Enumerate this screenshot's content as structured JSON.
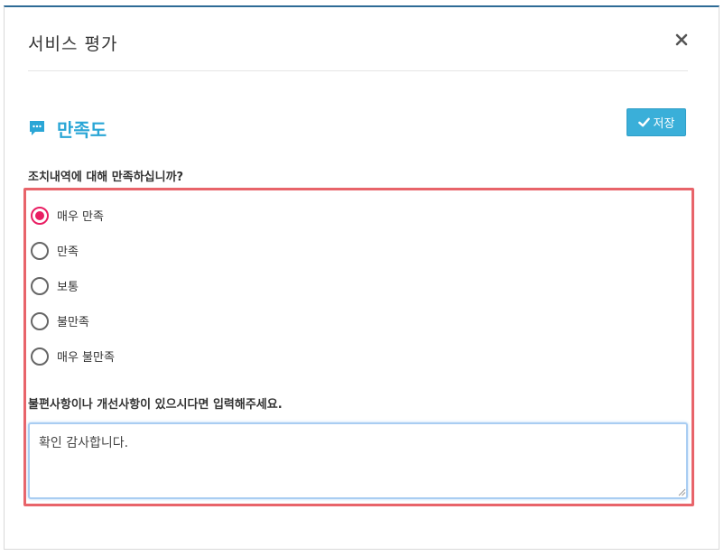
{
  "modal": {
    "title": "서비스 평가",
    "close_label": "×"
  },
  "section": {
    "icon": "speech-bubble-icon",
    "title": "만족도",
    "save_label": "저장",
    "save_icon": "check-icon"
  },
  "survey": {
    "question": "조치내역에 대해 만족하십니까?",
    "options": [
      {
        "label": "매우 만족",
        "checked": true
      },
      {
        "label": "만족",
        "checked": false
      },
      {
        "label": "보통",
        "checked": false
      },
      {
        "label": "불만족",
        "checked": false
      },
      {
        "label": "매우 불만족",
        "checked": false
      }
    ],
    "comment_label": "불편사항이나 개선사항이 있으시다면 입력해주세요.",
    "comment_value": "확인 감사합니다."
  },
  "colors": {
    "accent": "#2aa6d6",
    "save_button": "#3aafd9",
    "radio_checked": "#e91e63",
    "highlight_frame": "#e8646a",
    "textarea_focus": "#a9cdf2"
  }
}
